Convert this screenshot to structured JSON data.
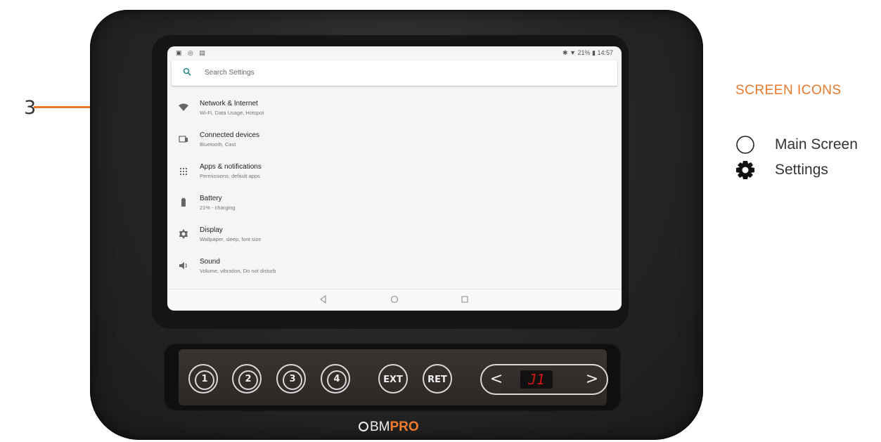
{
  "callout": {
    "number": "3"
  },
  "device": {
    "screen": {
      "statusbar": {
        "left": "▣ ◎ ▤",
        "right": "✱ ▼ 21% ▮ 14:57"
      },
      "search": {
        "placeholder": "Search Settings"
      },
      "items": [
        {
          "icon": "wifi-icon",
          "title": "Network & Internet",
          "subtitle": "Wi-Fi, Data Usage, Hotspot"
        },
        {
          "icon": "devices-icon",
          "title": "Connected devices",
          "subtitle": "Bluetooth, Cast"
        },
        {
          "icon": "apps-grid-icon",
          "title": "Apps & notifications",
          "subtitle": "Permissions, default apps"
        },
        {
          "icon": "battery-icon",
          "title": "Battery",
          "subtitle": "21% - charging"
        },
        {
          "icon": "brightness-icon",
          "title": "Display",
          "subtitle": "Wallpaper, sleep, font size"
        },
        {
          "icon": "volume-icon",
          "title": "Sound",
          "subtitle": "Volume, vibration, Do not disturb"
        }
      ]
    },
    "panel": {
      "buttons": [
        "1",
        "2",
        "3",
        "4"
      ],
      "ext_label": "EXT",
      "ret_label": "RET",
      "display_value": "J1",
      "prev_symbol": "<",
      "next_symbol": ">"
    },
    "brand": {
      "bm": "BM",
      "pro": "PRO"
    }
  },
  "legend": {
    "title": "SCREEN ICONS",
    "items": [
      {
        "icon": "circle-icon",
        "label": "Main Screen"
      },
      {
        "icon": "gear-icon",
        "label": "Settings"
      }
    ]
  },
  "colors": {
    "accent": "#e8792b",
    "display_red": "#d01515"
  }
}
